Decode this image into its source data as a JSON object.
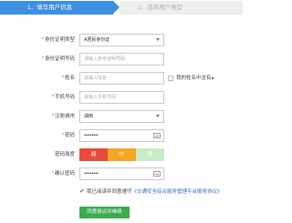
{
  "steps": {
    "step1_label": "1．填写用户信息",
    "step2_label": "2．选择用户类型"
  },
  "form": {
    "id_type": {
      "label": "身份证明类型",
      "value": "A居民身份证"
    },
    "id_number": {
      "label": "身份证明号码",
      "placeholder": "请输入身份证明号码"
    },
    "name": {
      "label": "姓名",
      "placeholder": "请输入姓名"
    },
    "rare_char": {
      "label": "我的姓名中含有"
    },
    "mobile": {
      "label": "手机号码",
      "placeholder": "请输入手机号码"
    },
    "region": {
      "label": "注册城市",
      "value": "湖南"
    },
    "password": {
      "label": "密码",
      "value": "•••••••••"
    },
    "strength": {
      "label": "密码强度",
      "weak": "弱",
      "medium": "中",
      "strong": "强"
    },
    "confirm_password": {
      "label": "确认密码",
      "value": "•••••••••"
    },
    "agreement": {
      "text": "我已阅读并同意遵守",
      "link": "《交通安全综合服务管理平台服务协议》"
    },
    "submit_label": "同意协议并继续"
  },
  "colors": {
    "step_active": "#3f8fe0",
    "weak": "#e84b3c",
    "medium": "#f5a623",
    "strong": "#c8ecc8",
    "submit": "#3aab4f"
  },
  "icons": {
    "dropdown": "chevron-down-icon",
    "keyboard": "keyboard-icon",
    "agree_check": "checkmark-icon"
  }
}
